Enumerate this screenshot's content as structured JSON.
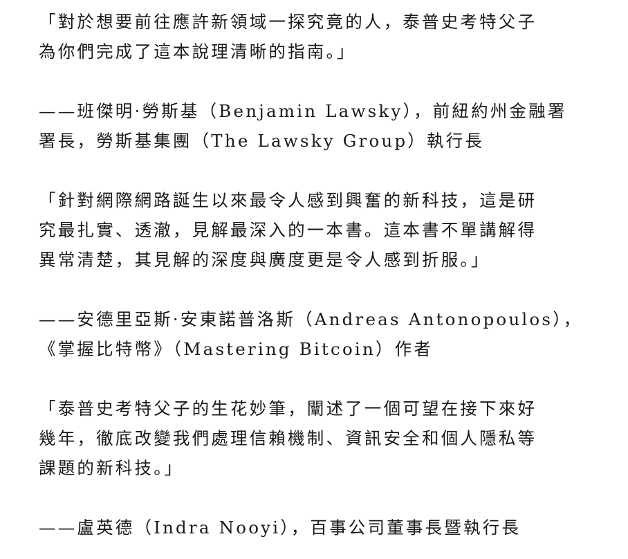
{
  "document": {
    "blocks": [
      {
        "type": "quote",
        "lines": [
          "「對於想要前往應許新領域一探究竟的人，泰普史考特父子",
          "為你們完成了這本說理清晰的指南。」"
        ]
      },
      {
        "type": "attribution",
        "lines": [
          "——班傑明·勞斯基（Benjamin Lawsky），前紐約州金融署",
          "署長，勞斯基集團（The Lawsky Group）執行長"
        ]
      },
      {
        "type": "quote",
        "lines": [
          "「針對網際網路誕生以來最令人感到興奮的新科技，這是研",
          "究最扎實、透澈，見解最深入的一本書。這本書不單講解得",
          "異常清楚，其見解的深度與廣度更是令人感到折服。」"
        ]
      },
      {
        "type": "attribution",
        "lines": [
          "——安德里亞斯·安東諾普洛斯（Andreas Antonopoulos），",
          "《掌握比特幣》（Mastering Bitcoin）作者"
        ]
      },
      {
        "type": "quote",
        "lines": [
          "「泰普史考特父子的生花妙筆，闡述了一個可望在接下來好",
          "幾年，徹底改變我們處理信賴機制、資訊安全和個人隱私等",
          "課題的新科技。」"
        ]
      },
      {
        "type": "attribution",
        "lines": [
          "——盧英德（Indra Nooyi），百事公司董事長暨執行長"
        ]
      }
    ]
  }
}
